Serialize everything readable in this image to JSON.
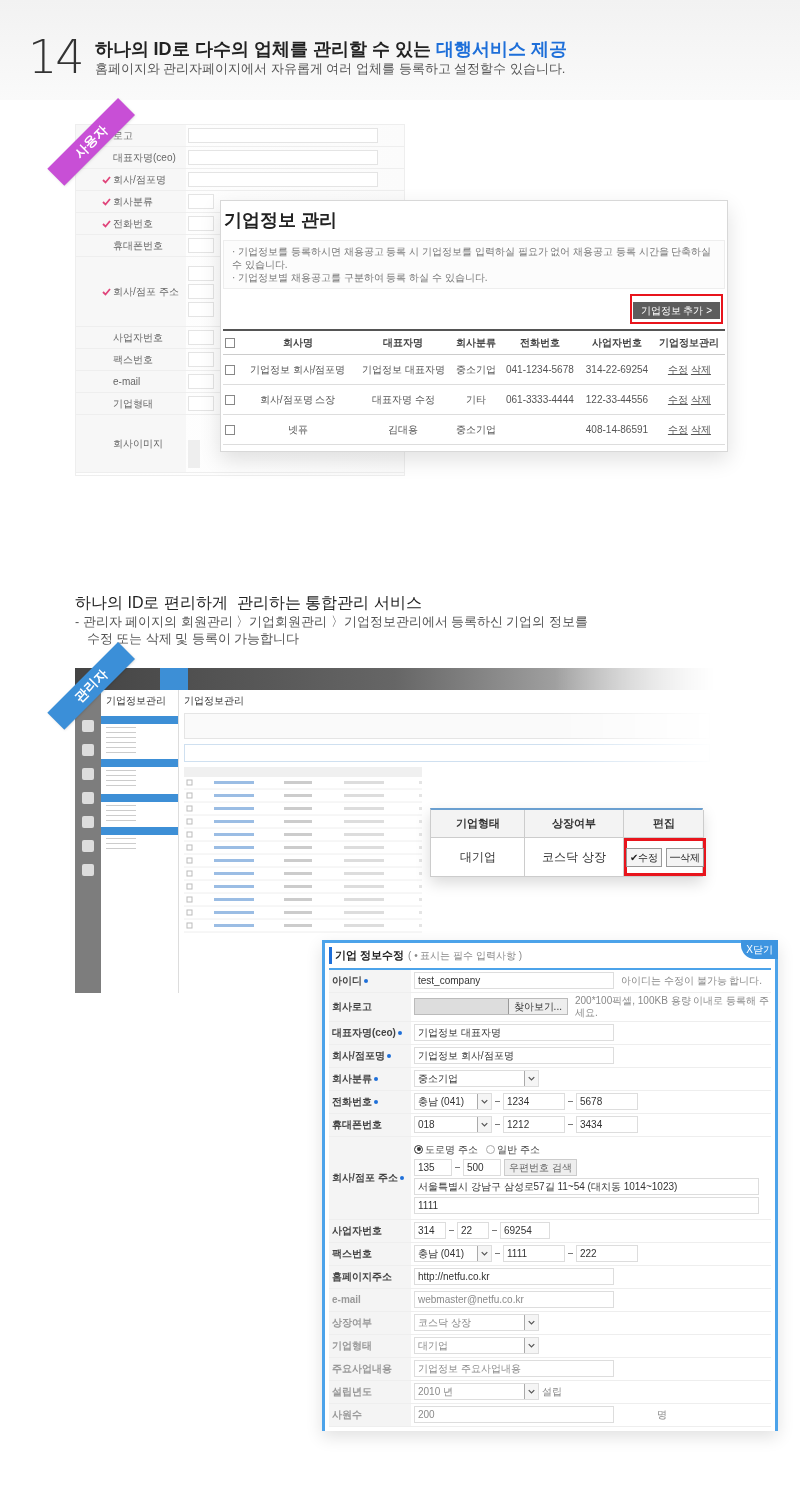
{
  "header": {
    "number": "14",
    "title": "하나의 ID로 다수의 업체를 관리할 수 있는 ",
    "title_highlight": "대행서비스 제공",
    "subtitle": "홈페이지와 관리자페이지에서 자유롭게 여러 업체를 등록하고 설정할수 있습니다."
  },
  "user_section": {
    "ribbon": "사용자",
    "form_rows": [
      {
        "label": "로고",
        "required": false,
        "kind": "plain"
      },
      {
        "label": "대표자명(ceo)",
        "required": false,
        "kind": "plain"
      },
      {
        "label": "회사/점포명",
        "required": true,
        "kind": "plain"
      },
      {
        "label": "회사분류",
        "required": true,
        "kind": "plain"
      },
      {
        "label": "전화번호",
        "required": true,
        "kind": "plain"
      },
      {
        "label": "휴대폰번호",
        "required": false,
        "kind": "plain"
      },
      {
        "label": "회사/점포 주소",
        "required": true,
        "kind": "tall"
      },
      {
        "label": "사업자번호",
        "required": false,
        "kind": "plain"
      },
      {
        "label": "팩스번호",
        "required": false,
        "kind": "plain"
      },
      {
        "label": "e-mail",
        "required": false,
        "kind": "plain"
      },
      {
        "label": "기업형태",
        "required": false,
        "kind": "plain"
      },
      {
        "label": "회사이미지",
        "required": false,
        "kind": "image"
      }
    ],
    "panel": {
      "title": "기업정보 관리",
      "notes": [
        "· 기업정보를 등록하시면 채용공고 등록 시 기업정보를 입력하실 필요가 없어 채용공고 등록 시간을 단축하실 수 있습니다.",
        "· 기업정보별 채용공고를 구분하여 등록 하실 수 있습니다."
      ],
      "add_button": "기업정보 추가 >",
      "select_all_checked": false,
      "columns": [
        "회사명",
        "대표자명",
        "회사분류",
        "전화번호",
        "사업자번호",
        "기업정보관리"
      ],
      "rows": [
        {
          "checked": false,
          "cells": [
            "기업정보 회사/점포명",
            "기업정보 대표자명",
            "중소기업",
            "041-1234-5678",
            "314-22-69254"
          ],
          "edit": "수정",
          "delete": "삭제"
        },
        {
          "checked": false,
          "cells": [
            "회사/점포명 스장",
            "대표자명 수정",
            "기타",
            "061-3333-4444",
            "122-33-44556"
          ],
          "edit": "수정",
          "delete": "삭제"
        },
        {
          "checked": false,
          "cells": [
            "넷퓨",
            "김대용",
            "중소기업",
            null,
            "408-14-86591"
          ],
          "edit": "수정",
          "delete": "삭제"
        }
      ]
    }
  },
  "service": {
    "title": "하나의 ID로 편리하게  관리하는 통합관리 서비스",
    "lines": [
      "- 관리자 페이지의 회원관리 〉기업회원관리 〉기업정보관리에서 등록하신 기업의 정보를",
      "수정 또는 삭제 및 등록이 가능합니다"
    ]
  },
  "admin_section": {
    "ribbon": "관리자",
    "sidebar_title": "기업정보관리",
    "page_title": "기업정보관리",
    "overlay_table": {
      "columns": [
        "기업형태",
        "상장여부",
        "편집"
      ],
      "cells": [
        "대기업",
        "코스닥 상장"
      ],
      "edit": "✔수정",
      "delete": "━삭제"
    },
    "edit_form": {
      "title": "기업 정보수정",
      "hint": "( • 표시는 필수 입력사항 )",
      "close": "X닫기",
      "rows": [
        {
          "kind": "text",
          "label": "아이디",
          "required": true,
          "faded": false,
          "value": "test_company",
          "note": "아이디는 수정이 불가능 합니다."
        },
        {
          "kind": "file",
          "label": "회사로고",
          "required": false,
          "faded": false,
          "button": "찾아보기...",
          "note": "200*100픽셀, 100KB 용량 이내로 등록해 주세요."
        },
        {
          "kind": "text",
          "label": "대표자명(ceo)",
          "required": true,
          "faded": false,
          "value": "기업정보 대표자명"
        },
        {
          "kind": "text",
          "label": "회사/점포명",
          "required": true,
          "faded": false,
          "value": "기업정보 회사/점포명"
        },
        {
          "kind": "select",
          "label": "회사분류",
          "required": true,
          "faded": false,
          "value": "중소기업"
        },
        {
          "kind": "phone",
          "label": "전화번호",
          "required": true,
          "faded": false,
          "value": "충남 (041)",
          "parts": [
            "1234",
            "5678"
          ]
        },
        {
          "kind": "phone",
          "label": "휴대폰번호",
          "required": false,
          "faded": false,
          "value": "018",
          "parts": [
            "1212",
            "3434"
          ]
        },
        {
          "kind": "address",
          "label": "회사/점포 주소",
          "required": true,
          "faded": false,
          "radios": [
            {
              "label": "도로명 주소",
              "selected": true
            },
            {
              "label": "일반 주소",
              "selected": false
            }
          ],
          "zip": [
            "135",
            "500"
          ],
          "zip_button": "우편번호 검색",
          "lines": [
            "서울특별시 강남구 삼성로57길 11~54 (대치동 1014~1023)",
            "1111"
          ]
        },
        {
          "kind": "parts",
          "label": "사업자번호",
          "required": false,
          "faded": false,
          "parts": [
            "314",
            "22",
            "69254"
          ]
        },
        {
          "kind": "phone",
          "label": "팩스번호",
          "required": false,
          "faded": false,
          "value": "충남 (041)",
          "parts": [
            "1111",
            "222"
          ]
        },
        {
          "kind": "text",
          "label": "홈페이지주소",
          "required": false,
          "faded": false,
          "value": "http://netfu.co.kr"
        },
        {
          "kind": "text",
          "label": "e-mail",
          "required": false,
          "faded": true,
          "value": "webmaster@netfu.co.kr"
        },
        {
          "kind": "select",
          "label": "상장여부",
          "required": false,
          "faded": true,
          "value": "코스닥 상장"
        },
        {
          "kind": "select",
          "label": "기업형태",
          "required": false,
          "faded": true,
          "value": "대기업"
        },
        {
          "kind": "text",
          "label": "주요사업내용",
          "required": false,
          "faded": true,
          "value": "기업정보 주요사업내용"
        },
        {
          "kind": "select",
          "label": "설립년도",
          "required": false,
          "faded": true,
          "value": "2010 년",
          "suffix": "설립"
        },
        {
          "kind": "text",
          "label": "사원수",
          "required": false,
          "faded": true,
          "value": "200",
          "suffix": "명"
        }
      ]
    }
  }
}
